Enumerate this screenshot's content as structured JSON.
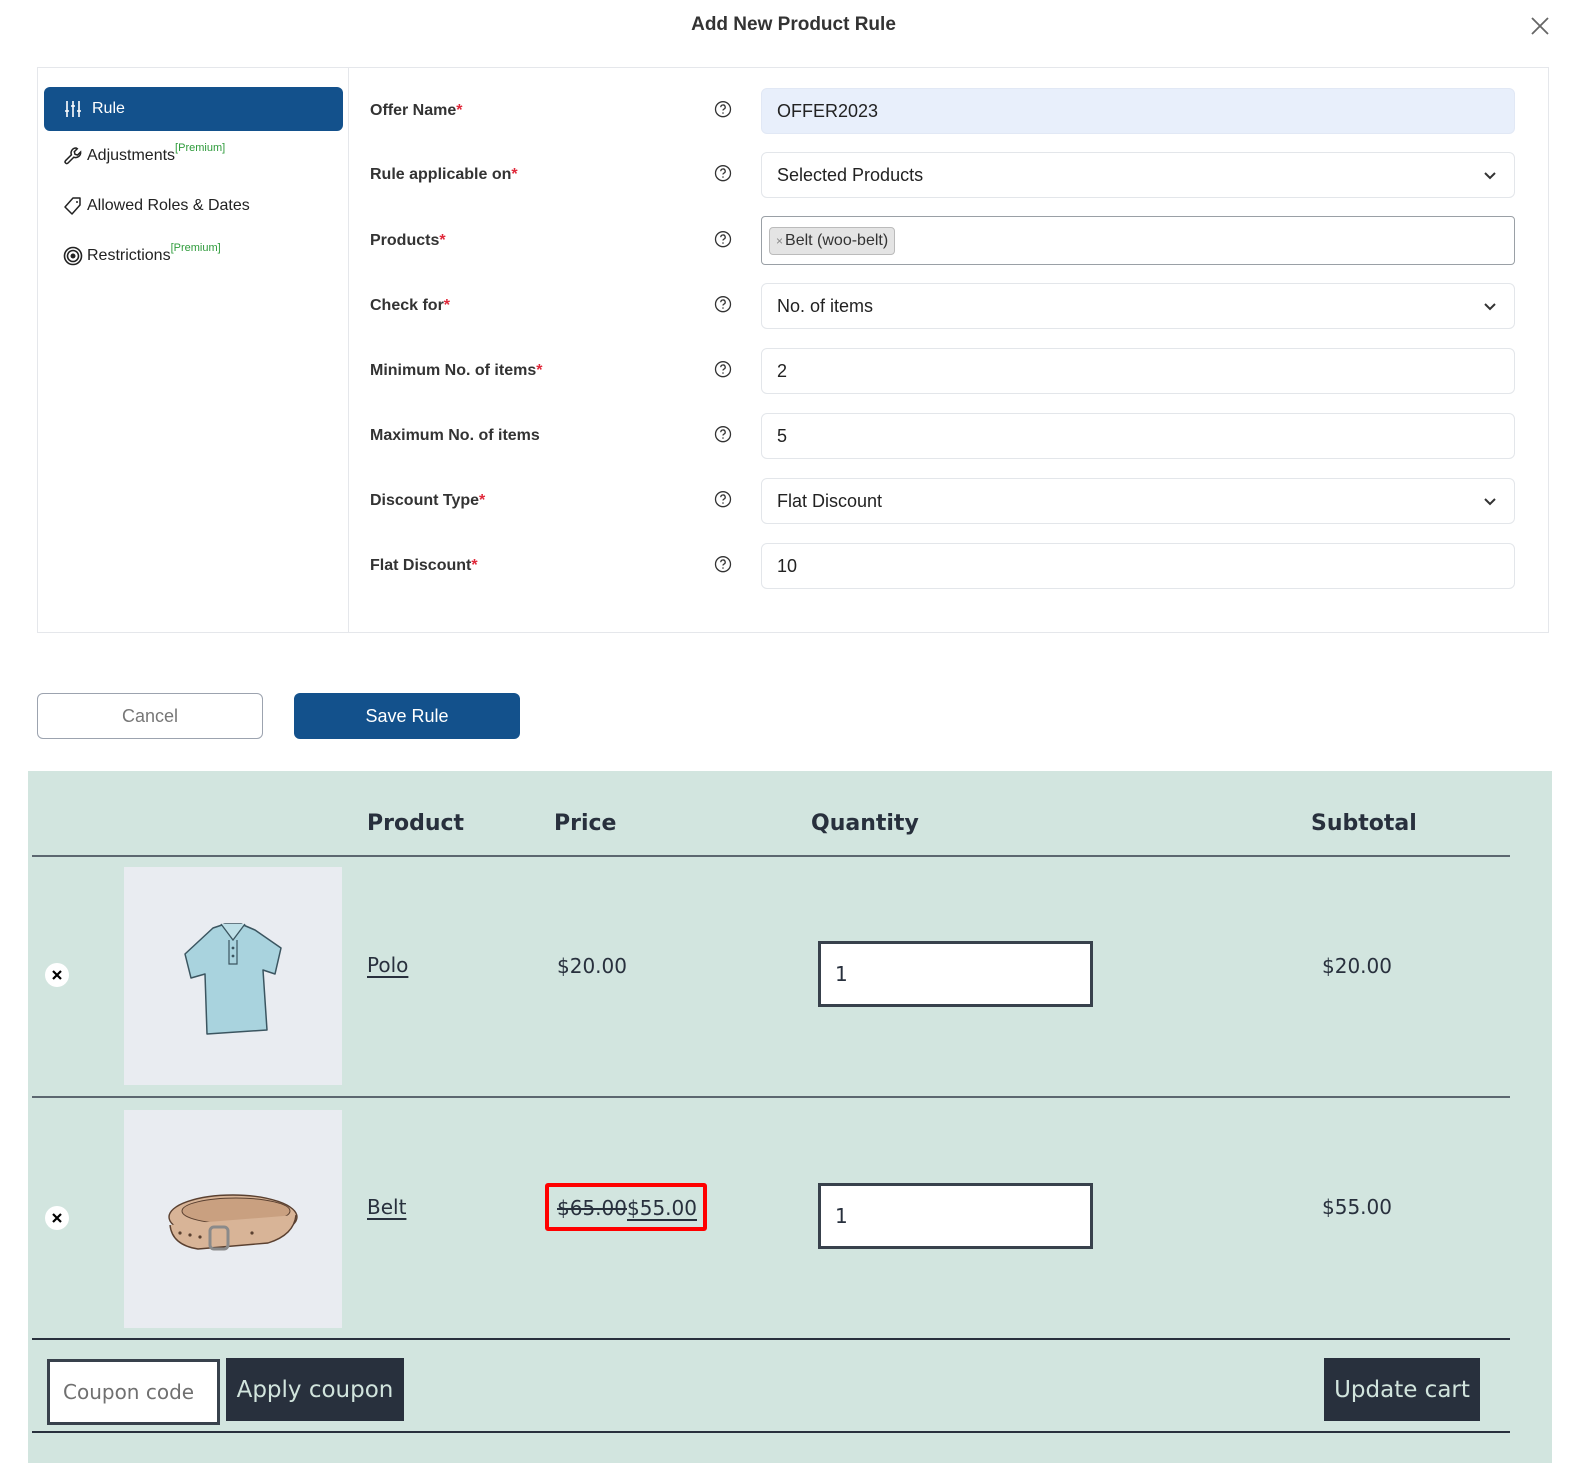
{
  "modal": {
    "title": "Add New Product Rule",
    "close_icon": "close-icon"
  },
  "sidenav": {
    "items": [
      {
        "label": "Rule",
        "icon": "sliders-icon",
        "active": true,
        "badge": ""
      },
      {
        "label": "Adjustments",
        "icon": "wrench-icon",
        "active": false,
        "badge": "[Premium]"
      },
      {
        "label": "Allowed Roles & Dates",
        "icon": "tag-icon",
        "active": false,
        "badge": ""
      },
      {
        "label": "Restrictions",
        "icon": "target-icon",
        "active": false,
        "badge": "[Premium]"
      }
    ]
  },
  "form": {
    "fields": [
      {
        "label": "Offer Name",
        "required": "*",
        "value": "OFFER2023",
        "type": "text"
      },
      {
        "label": "Rule applicable on",
        "required": "*",
        "value": "Selected Products",
        "type": "select"
      },
      {
        "label": "Products",
        "required": "*",
        "tags": [
          "Belt (woo-belt)"
        ],
        "type": "tags"
      },
      {
        "label": "Check for",
        "required": "*",
        "value": "No. of items",
        "type": "select"
      },
      {
        "label": "Minimum No. of items",
        "required": "*",
        "value": "2",
        "type": "number"
      },
      {
        "label": "Maximum No. of items",
        "required": "",
        "value": "5",
        "type": "number"
      },
      {
        "label": "Discount Type",
        "required": "*",
        "value": "Flat Discount",
        "type": "select"
      },
      {
        "label": "Flat Discount",
        "required": "*",
        "value": "10",
        "type": "number"
      }
    ]
  },
  "actions": {
    "cancel_label": "Cancel",
    "save_label": "Save Rule"
  },
  "cart": {
    "headers": {
      "product": "Product",
      "price": "Price",
      "quantity": "Quantity",
      "subtotal": "Subtotal"
    },
    "rows": [
      {
        "name": "Polo",
        "price": "$20.00",
        "old_price": "",
        "quantity": "1",
        "subtotal": "$20.00",
        "image": "polo-shirt"
      },
      {
        "name": "Belt",
        "price": "$55.00",
        "old_price": "$65.00",
        "quantity": "1",
        "subtotal": "$55.00",
        "image": "belt"
      }
    ],
    "coupon_placeholder": "Coupon code",
    "apply_coupon_label": "Apply coupon",
    "update_cart_label": "Update cart"
  },
  "colors": {
    "primary": "#13518c",
    "premium": "#2e9b3b",
    "required": "#e0293b",
    "cart_bg": "#d2e5df",
    "dark_button": "#28303d",
    "highlight": "#ff0000"
  }
}
